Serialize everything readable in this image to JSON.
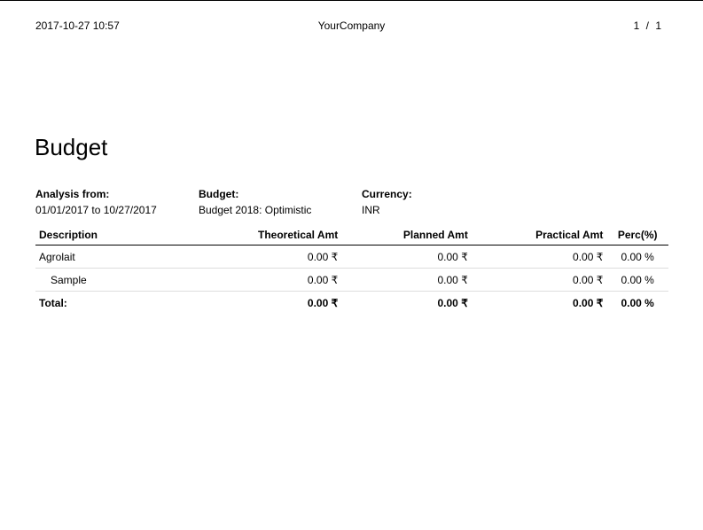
{
  "header": {
    "datetime": "2017-10-27 10:57",
    "company": "YourCompany",
    "page_current": "1",
    "page_separator": "/",
    "page_total": "1"
  },
  "report": {
    "title": "Budget",
    "analysis_label": "Analysis from:",
    "analysis_value": "01/01/2017 to 10/27/2017",
    "budget_label": "Budget:",
    "budget_value": "Budget 2018: Optimistic",
    "currency_label": "Currency:",
    "currency_value": "INR"
  },
  "table": {
    "columns": {
      "description": "Description",
      "theoretical": "Theoretical Amt",
      "planned": "Planned Amt",
      "practical": "Practical Amt",
      "percentage": "Perc(%)"
    },
    "rows": [
      {
        "description": "Agrolait",
        "theoretical": "0.00 ₹",
        "planned": "0.00 ₹",
        "practical": "0.00 ₹",
        "percentage": "0.00 %"
      },
      {
        "description": "Sample",
        "theoretical": "0.00 ₹",
        "planned": "0.00 ₹",
        "practical": "0.00 ₹",
        "percentage": "0.00 %"
      }
    ],
    "total": {
      "label": "Total:",
      "theoretical": "0.00 ₹",
      "planned": "0.00 ₹",
      "practical": "0.00 ₹",
      "percentage": "0.00 %"
    }
  }
}
